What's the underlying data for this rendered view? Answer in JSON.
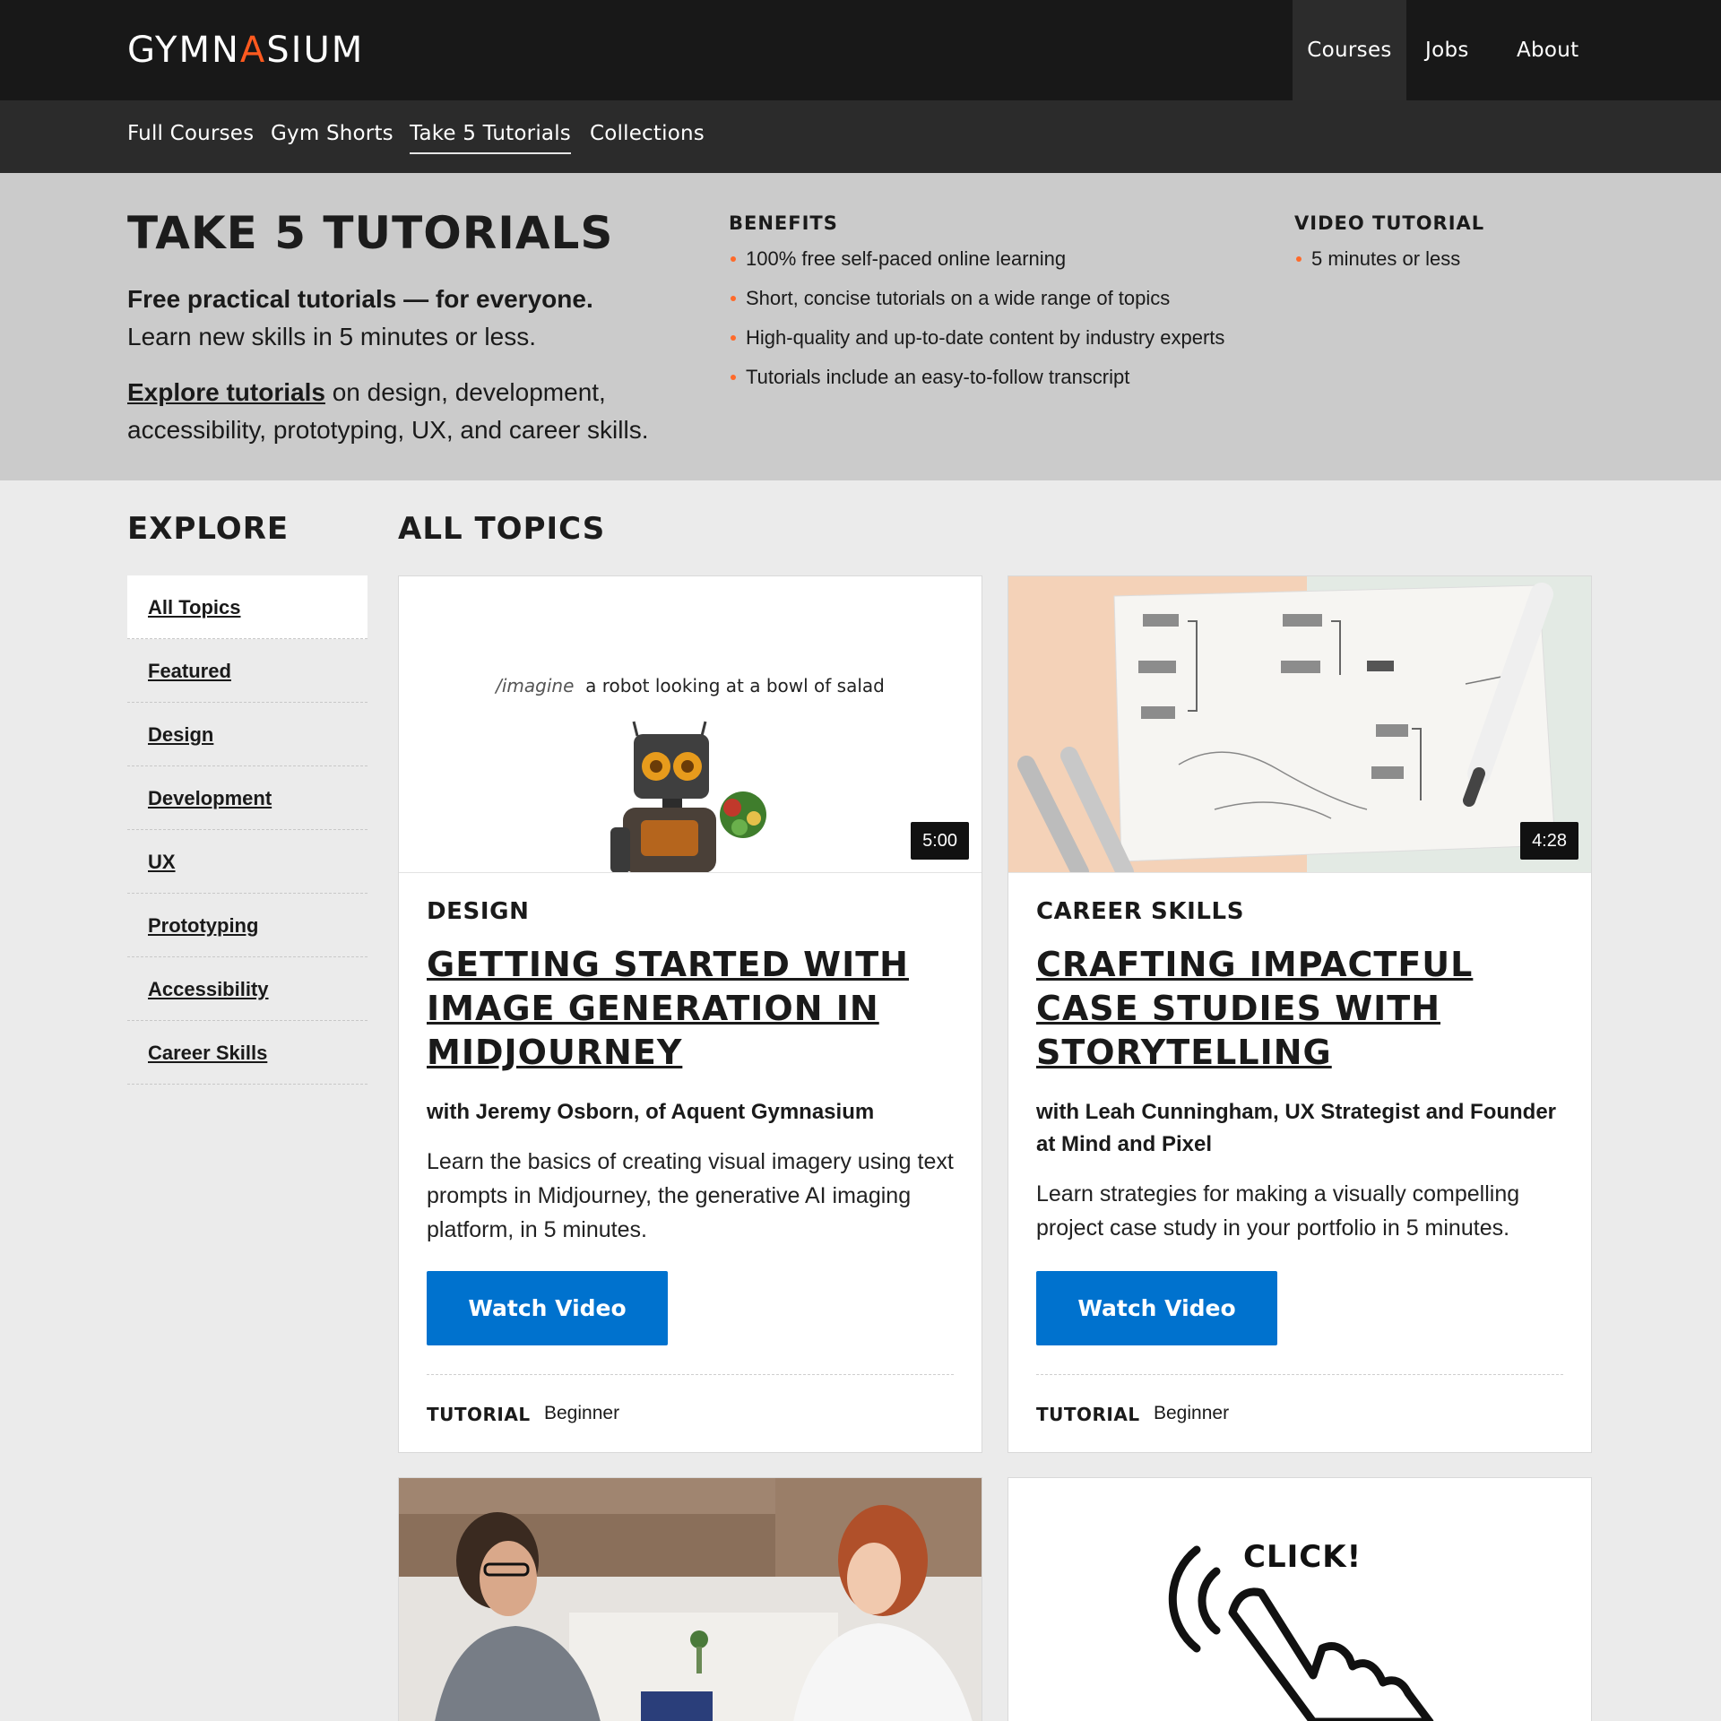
{
  "header": {
    "logo_pre": "GYMN",
    "logo_a": "A",
    "logo_post": "SIUM",
    "nav": [
      {
        "label": "Courses",
        "active": true
      },
      {
        "label": "Jobs",
        "active": false
      },
      {
        "label": "About",
        "active": false
      }
    ]
  },
  "subnav": {
    "items": [
      {
        "label": "Full Courses"
      },
      {
        "label": "Gym Shorts"
      },
      {
        "label": "Take 5 Tutorials",
        "active": true
      },
      {
        "label": "Collections"
      }
    ]
  },
  "hero": {
    "title": "TAKE 5 TUTORIALS",
    "lead_strong": "Free practical tutorials — for everyone.",
    "lead_text": "Learn new skills in 5 minutes or less.",
    "explore_link": "Explore tutorials",
    "explore_text": " on design, development, accessibility, prototyping, UX, and career skills.",
    "benefits_title": "BENEFITS",
    "benefits": [
      "100% free self-paced online learning",
      "Short, concise tutorials on a wide range of topics",
      "High-quality and up-to-date content by industry experts",
      "Tutorials include an easy-to-follow transcript"
    ],
    "video_title": "VIDEO TUTORIAL",
    "video_items": [
      "5 minutes or less"
    ]
  },
  "explore": {
    "title": "EXPLORE",
    "items": [
      {
        "label": "All Topics",
        "active": true
      },
      {
        "label": "Featured"
      },
      {
        "label": "Design"
      },
      {
        "label": "Development"
      },
      {
        "label": "UX"
      },
      {
        "label": "Prototyping"
      },
      {
        "label": "Accessibility"
      },
      {
        "label": "Career Skills"
      }
    ]
  },
  "main": {
    "title": "ALL TOPICS",
    "cards": [
      {
        "category": "DESIGN",
        "title": "Getting Started with Image Generation in Midjourney",
        "author": "with Jeremy Osborn, of Aquent Gymnasium",
        "description": "Learn the basics of creating visual imagery using text prompts in Midjourney, the generative AI imaging platform, in 5 minutes.",
        "duration": "5:00",
        "button": "Watch Video",
        "type": "TUTORIAL",
        "level": "Beginner",
        "thumb_prompt_cmd": "/imagine",
        "thumb_prompt_text": "a robot looking at a bowl of salad"
      },
      {
        "category": "CAREER SKILLS",
        "title": "Crafting Impactful Case Studies with Storytelling",
        "author": "with Leah Cunningham, UX Strategist and Founder at Mind and Pixel",
        "description": "Learn strategies for making a visually compelling project case study in your portfolio in 5 minutes.",
        "duration": "4:28",
        "button": "Watch Video",
        "type": "TUTORIAL",
        "level": "Beginner"
      },
      {
        "thumb": "two-people-meeting-photo"
      },
      {
        "thumb_text": "CLICK!"
      }
    ]
  },
  "colors": {
    "accent": "#ff5a1f",
    "button": "#0072ce",
    "header": "#181818",
    "subnav": "#2b2b2b",
    "hero": "#cbcbcb"
  }
}
